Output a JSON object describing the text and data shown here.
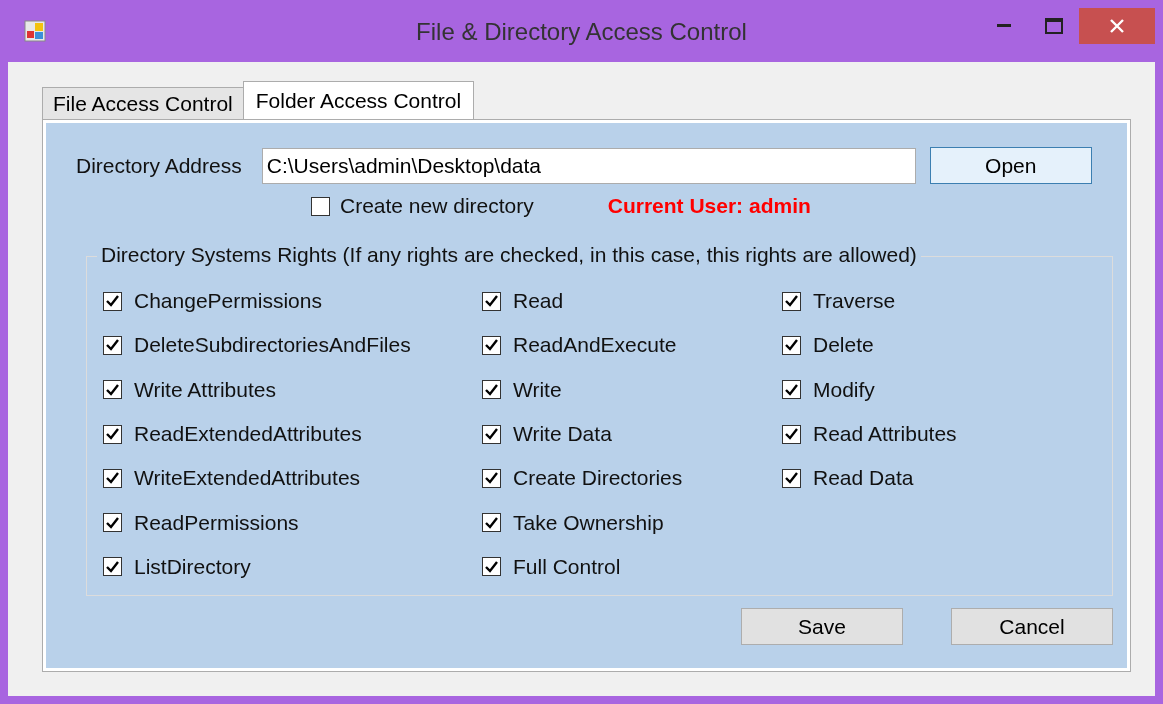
{
  "window": {
    "title": "File & Directory Access Control"
  },
  "tabs": [
    {
      "label": "File Access Control",
      "selected": false
    },
    {
      "label": "Folder Access Control",
      "selected": true
    }
  ],
  "directory": {
    "label": "Directory Address",
    "value": "C:\\Users\\admin\\Desktop\\data",
    "open_button": "Open"
  },
  "create_new": {
    "label": "Create new directory",
    "checked": false
  },
  "current_user": "Current User: admin",
  "rights": {
    "title": "Directory Systems Rights (If any rights are checked, in this case, this rights are allowed)",
    "columns": [
      [
        {
          "label": "ChangePermissions",
          "checked": true
        },
        {
          "label": "DeleteSubdirectoriesAndFiles",
          "checked": true
        },
        {
          "label": "Write Attributes",
          "checked": true
        },
        {
          "label": "ReadExtendedAttributes",
          "checked": true
        },
        {
          "label": "WriteExtendedAttributes",
          "checked": true
        },
        {
          "label": "ReadPermissions",
          "checked": true
        },
        {
          "label": "ListDirectory",
          "checked": true
        }
      ],
      [
        {
          "label": "Read",
          "checked": true
        },
        {
          "label": "ReadAndExecute",
          "checked": true
        },
        {
          "label": "Write",
          "checked": true
        },
        {
          "label": "Write Data",
          "checked": true
        },
        {
          "label": "Create Directories",
          "checked": true
        },
        {
          "label": "Take Ownership",
          "checked": true
        },
        {
          "label": "Full Control",
          "checked": true
        }
      ],
      [
        {
          "label": "Traverse",
          "checked": true
        },
        {
          "label": "Delete",
          "checked": true
        },
        {
          "label": "Modify",
          "checked": true
        },
        {
          "label": "Read Attributes",
          "checked": true
        },
        {
          "label": "Read Data",
          "checked": true
        }
      ]
    ]
  },
  "buttons": [
    "Save",
    "Cancel"
  ]
}
